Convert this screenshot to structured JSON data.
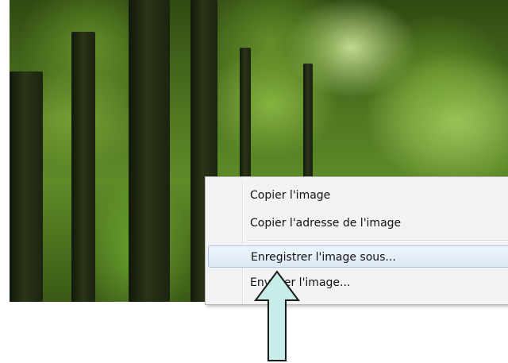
{
  "background_photo": {
    "subject": "forest-trees",
    "colors": {
      "canopy_light": "#d6f0a0",
      "canopy_mid": "#5e8c28",
      "trunk": "#1a2410"
    }
  },
  "context_menu": {
    "items": [
      {
        "label": "Copier l'image"
      },
      {
        "label": "Copier l'adresse de l'image"
      },
      {
        "label": "Enregistrer l'image sous..."
      },
      {
        "label": "Envoyer l'image..."
      }
    ],
    "highlighted_index": 2,
    "colors": {
      "background": "#f3f3f3",
      "highlight_border": "#a9c5e8",
      "highlight_fill": "#dce8f5"
    }
  },
  "pointer_arrow": {
    "icon": "up-arrow-icon",
    "colors": {
      "fill": "#c8ece8",
      "stroke": "#1a1a1a"
    }
  }
}
